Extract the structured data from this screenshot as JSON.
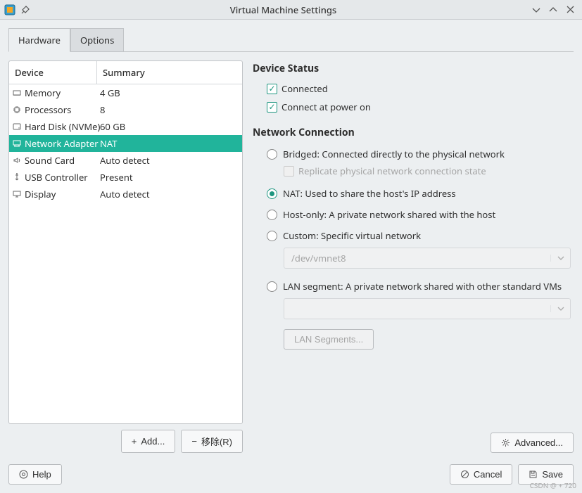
{
  "window": {
    "title": "Virtual Machine Settings"
  },
  "tabs": {
    "hardware": "Hardware",
    "options": "Options"
  },
  "table": {
    "header_device": "Device",
    "header_summary": "Summary",
    "rows": [
      {
        "name": "Memory",
        "summary": "4 GB"
      },
      {
        "name": "Processors",
        "summary": "8"
      },
      {
        "name": "Hard Disk (NVMe)",
        "summary": "60 GB"
      },
      {
        "name": "Network Adapter",
        "summary": "NAT"
      },
      {
        "name": "Sound Card",
        "summary": "Auto detect"
      },
      {
        "name": "USB Controller",
        "summary": "Present"
      },
      {
        "name": "Display",
        "summary": "Auto detect"
      }
    ]
  },
  "device_actions": {
    "add": "Add...",
    "remove": "移除(R)"
  },
  "right": {
    "status_title": "Device Status",
    "connected": "Connected",
    "connect_power": "Connect at power on",
    "net_title": "Network Connection",
    "bridged": "Bridged: Connected directly to the physical network",
    "replicate": "Replicate physical network connection state",
    "nat": "NAT: Used to share the host's IP address",
    "hostonly": "Host-only: A private network shared with the host",
    "custom": "Custom: Specific virtual network",
    "custom_value": "/dev/vmnet8",
    "lanseg": "LAN segment: A private network shared with other standard VMs",
    "lan_segments_btn": "LAN Segments...",
    "advanced": "Advanced..."
  },
  "footer": {
    "help": "Help",
    "cancel": "Cancel",
    "save": "Save"
  },
  "watermark": "CSDN @ + 720"
}
